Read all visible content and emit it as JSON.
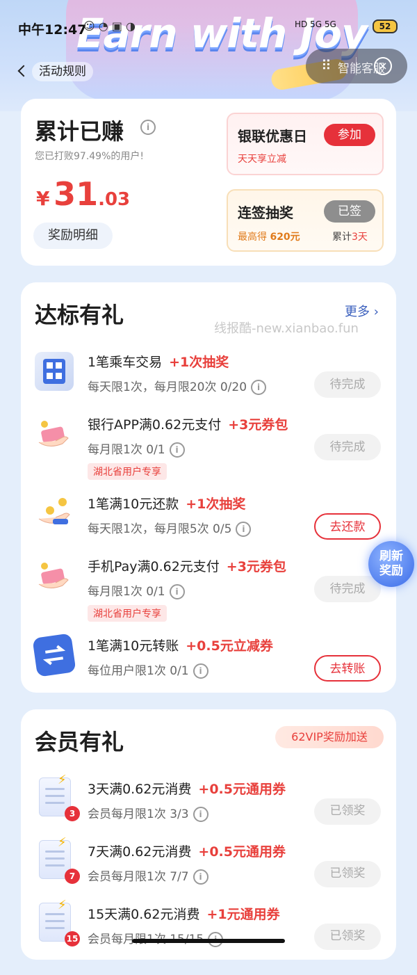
{
  "banner": {
    "title": "Earn with Joy"
  },
  "status_bar": {
    "time": "中午12:47",
    "network": "HD 5G 5G",
    "battery": "52"
  },
  "nav": {
    "back_label": "活动规则",
    "service_label": "智能客服"
  },
  "earnings": {
    "title": "累计已赚",
    "subtitle": "您已打败97.49%的用户!",
    "currency": "¥",
    "amount_int": "31",
    "amount_dec": ".03",
    "detail_button": "奖励明细",
    "promo_unionpay": {
      "title": "银联优惠日",
      "sub": "天天享立减",
      "button": "参加"
    },
    "promo_checkin": {
      "title": "连签抽奖",
      "sub_prefix": "最高得 ",
      "sub_value": "620元",
      "streak_prefix": "累计",
      "streak_value": "3天",
      "button": "已签"
    }
  },
  "tasks": {
    "title": "达标有礼",
    "more": "更多 ›",
    "watermark": "线报酷-new.xianbao.fun",
    "items": [
      {
        "name": "1笔乘车交易",
        "reward": "+1次抽奖",
        "limit": "每天限1次，每月限20次 0/20",
        "tag": "",
        "action": "待完成",
        "icon": "qrcode-icon"
      },
      {
        "name": "银行APP满0.62元支付",
        "reward": "+3元券包",
        "limit": "每月限1次 0/1",
        "tag": "湖北省用户专享",
        "action": "待完成",
        "icon": "money-hand-icon"
      },
      {
        "name": "1笔满10元还款",
        "reward": "+1次抽奖",
        "limit": "每天限1次，每月限5次 0/5",
        "tag": "",
        "action": "去还款",
        "icon": "coin-hand-icon"
      },
      {
        "name": "手机Pay满0.62元支付",
        "reward": "+3元券包",
        "limit": "每月限1次 0/1",
        "tag": "湖北省用户专享",
        "action": "待完成",
        "icon": "money-hand-icon"
      },
      {
        "name": "1笔满10元转账",
        "reward": "+0.5元立减券",
        "limit": "每位用户限1次 0/1",
        "tag": "",
        "action": "去转账",
        "icon": "transfer-icon"
      }
    ]
  },
  "refresh_button": {
    "line1": "刷新",
    "line2": "奖励"
  },
  "member": {
    "title": "会员有礼",
    "badge": "62VIP奖励加送",
    "items": [
      {
        "badge": "3",
        "name": "3天满0.62元消费",
        "reward": "+0.5元通用券",
        "limit": "会员每月限1次 3/3",
        "action": "已领奖"
      },
      {
        "badge": "7",
        "name": "7天满0.62元消费",
        "reward": "+0.5元通用券",
        "limit": "会员每月限1次 7/7",
        "action": "已领奖"
      },
      {
        "badge": "15",
        "name": "15天满0.62元消费",
        "reward": "+1元通用券",
        "limit": "会员每月限1次 15/15",
        "action": "已领奖"
      }
    ]
  },
  "colors": {
    "accent_red": "#e6313a",
    "background": "#e4eefb",
    "link_blue": "#3a5fbd"
  }
}
